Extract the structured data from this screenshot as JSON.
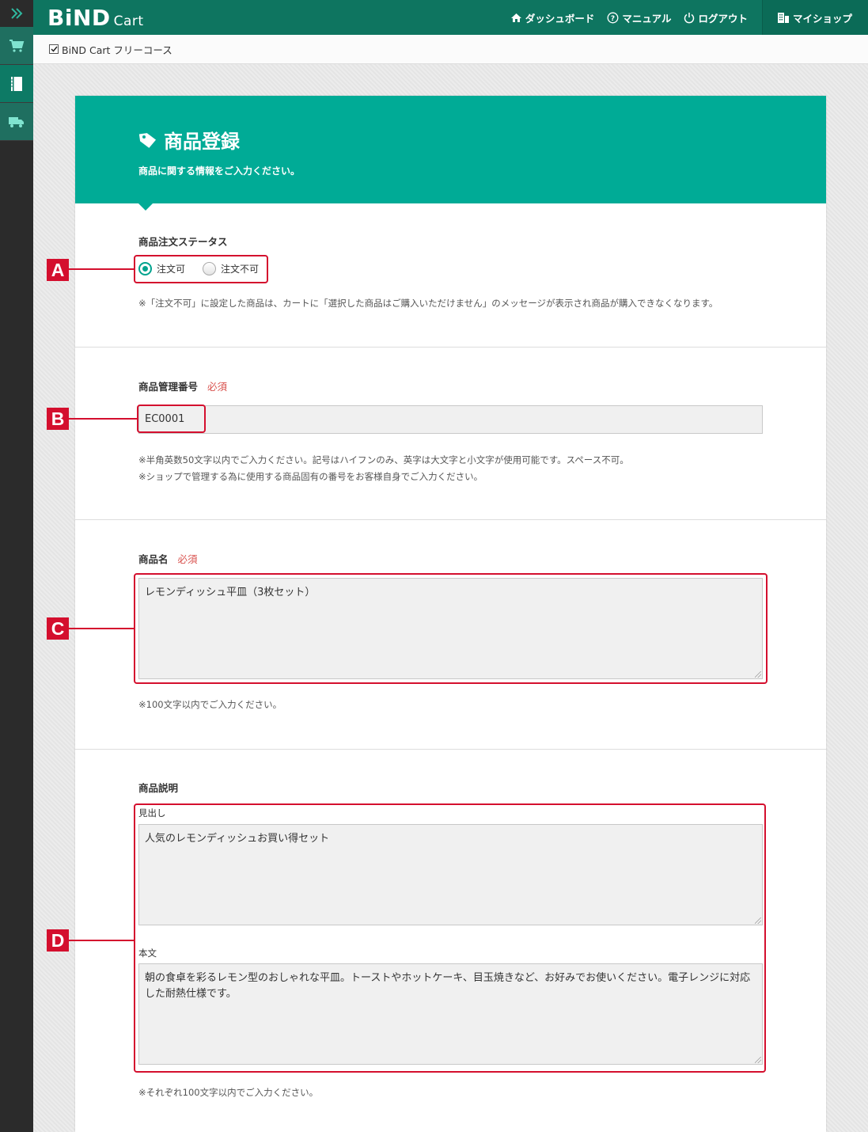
{
  "app": {
    "logo_main": "BiND",
    "logo_sub": "Cart"
  },
  "header": {
    "nav": [
      {
        "label": "ダッシュボード",
        "icon": "home-icon"
      },
      {
        "label": "マニュアル",
        "icon": "help-icon"
      },
      {
        "label": "ログアウト",
        "icon": "power-icon"
      }
    ],
    "myshop_label": "マイショップ"
  },
  "subbar": {
    "plan_label": "BiND Cart フリーコース"
  },
  "colors": {
    "brand": "#0e7560",
    "hero": "#00ab96",
    "accent_red": "#d40f2e"
  },
  "page": {
    "title": "商品登録",
    "subtitle": "商品に関する情報をご入力ください。"
  },
  "order_status": {
    "label": "商品注文ステータス",
    "options": [
      {
        "label": "注文可",
        "selected": true
      },
      {
        "label": "注文不可",
        "selected": false
      }
    ],
    "note": "※「注文不可」に設定した商品は、カートに「選択した商品はご購入いただけません」のメッセージが表示され商品が購入できなくなります。"
  },
  "product_code": {
    "label": "商品管理番号",
    "required": "必須",
    "value": "EC0001",
    "notes": [
      "※半角英数50文字以内でご入力ください。記号はハイフンのみ、英字は大文字と小文字が使用可能です。スペース不可。",
      "※ショップで管理する為に使用する商品固有の番号をお客様自身でご入力ください。"
    ]
  },
  "product_name": {
    "label": "商品名",
    "required": "必須",
    "value": "レモンディッシュ平皿（3枚セット）",
    "note": "※100文字以内でご入力ください。"
  },
  "product_desc": {
    "label": "商品説明",
    "heading_label": "見出し",
    "heading_value": "人気のレモンディッシュお買い得セット",
    "body_label": "本文",
    "body_value": "朝の食卓を彩るレモン型のおしゃれな平皿。トーストやホットケーキ、目玉焼きなど、お好みでお使いください。電子レンジに対応した耐熱仕様です。",
    "note": "※それぞれ100文字以内でご入力ください。"
  },
  "markers": [
    "A",
    "B",
    "C",
    "D"
  ]
}
